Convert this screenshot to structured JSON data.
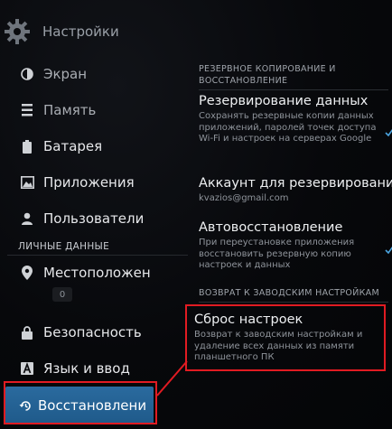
{
  "header": {
    "title": "Настройки"
  },
  "sidebar": {
    "items": [
      {
        "label": "Экран"
      },
      {
        "label": "Память"
      },
      {
        "label": "Батарея"
      },
      {
        "label": "Приложения"
      },
      {
        "label": "Пользователи"
      }
    ],
    "personal_section": "ЛИЧНЫЕ ДАННЫЕ",
    "personal_items": [
      {
        "label": "Местоположен"
      },
      {
        "label": "Безопасность"
      },
      {
        "label": "Язык и ввод"
      },
      {
        "label": "Восстановлени"
      }
    ],
    "location_badge": "0"
  },
  "main": {
    "backup_section": "РЕЗЕРВНОЕ КОПИРОВАНИЕ И ВОССТАНОВЛЕНИЕ",
    "backup_data": {
      "title": "Резервирование данных",
      "summary": "Сохранять резервные копии данных приложений, паролей точек доступа Wi-Fi и настроек на серверах Google"
    },
    "backup_account": {
      "title": "Аккаунт для резервирования",
      "summary": "kvazios@gmail.com"
    },
    "auto_restore": {
      "title": "Автовосстановление",
      "summary": "При переустановке приложения восстановить резервную копию настроек и данных"
    },
    "factory_section": "ВОЗВРАТ К ЗАВОДСКИМ НАСТРОЙКАМ",
    "factory_reset": {
      "title": "Сброс настроек",
      "summary": "Возврат к заводским настройкам и удаление всех данных из памяти планшетного ПК"
    }
  },
  "colors": {
    "accent": "#2a6a9e",
    "highlight": "#e11b22",
    "check": "#4aa3df"
  }
}
